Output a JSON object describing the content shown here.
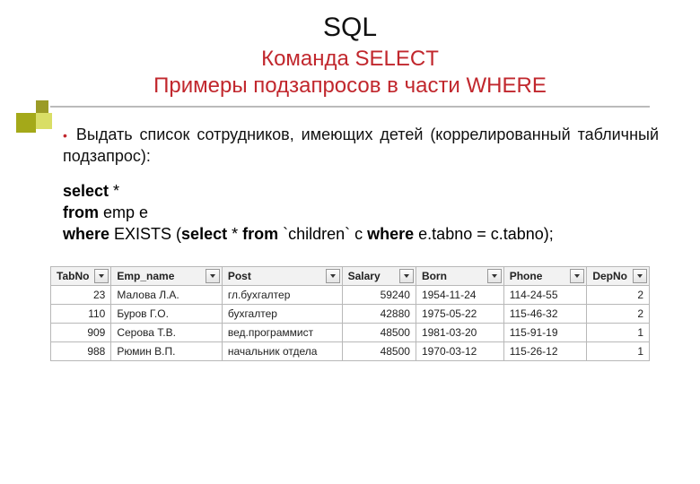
{
  "header": {
    "title": "SQL",
    "subtitle1": "Команда SELECT",
    "subtitle2": "Примеры подзапросов в части WHERE"
  },
  "body": {
    "bullet_text": "Выдать список сотрудников, имеющих детей (коррелированный табличный подзапрос):",
    "code_line1_b1": "select",
    "code_line1_r": " *",
    "code_line2_b1": "from",
    "code_line2_r": " emp e",
    "code_line3_b1": "where",
    "code_line3_m1": " EXISTS (",
    "code_line3_b2": "select",
    "code_line3_m2": " * ",
    "code_line3_b3": "from",
    "code_line3_m3": " `children` c ",
    "code_line3_b4": "where",
    "code_line3_m4": " e.tabno = c.tabno);"
  },
  "table": {
    "headers": {
      "tabno": "TabNo",
      "emp_name": "Emp_name",
      "post": "Post",
      "salary": "Salary",
      "born": "Born",
      "phone": "Phone",
      "depno": "DepNo"
    },
    "rows": [
      {
        "tabno": "23",
        "emp_name": "Малова Л.А.",
        "post": "гл.бухгалтер",
        "salary": "59240",
        "born": "1954-11-24",
        "phone": "114-24-55",
        "depno": "2"
      },
      {
        "tabno": "110",
        "emp_name": "Буров Г.О.",
        "post": "бухгалтер",
        "salary": "42880",
        "born": "1975-05-22",
        "phone": "115-46-32",
        "depno": "2"
      },
      {
        "tabno": "909",
        "emp_name": "Серова Т.В.",
        "post": "вед.программист",
        "salary": "48500",
        "born": "1981-03-20",
        "phone": "115-91-19",
        "depno": "1"
      },
      {
        "tabno": "988",
        "emp_name": "Рюмин В.П.",
        "post": "начальник отдела",
        "salary": "48500",
        "born": "1970-03-12",
        "phone": "115-26-12",
        "depno": "1"
      }
    ]
  }
}
